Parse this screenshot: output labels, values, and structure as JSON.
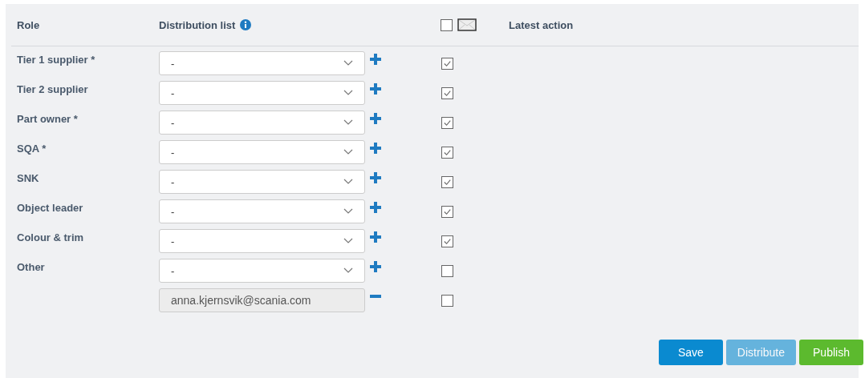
{
  "header": {
    "role": "Role",
    "distribution_list": "Distribution list",
    "select_all_checked": false,
    "latest_action": "Latest action"
  },
  "rows": [
    {
      "kind": "select",
      "role": "Tier 1 supplier *",
      "value": "-",
      "checked": true
    },
    {
      "kind": "select",
      "role": "Tier 2 supplier",
      "value": "-",
      "checked": true
    },
    {
      "kind": "select",
      "role": "Part owner *",
      "value": "-",
      "checked": true
    },
    {
      "kind": "select",
      "role": "SQA *",
      "value": "-",
      "checked": true
    },
    {
      "kind": "select",
      "role": "SNK",
      "value": "-",
      "checked": true
    },
    {
      "kind": "select",
      "role": "Object leader",
      "value": "-",
      "checked": true
    },
    {
      "kind": "select",
      "role": "Colour & trim",
      "value": "-",
      "checked": true
    },
    {
      "kind": "select",
      "role": "Other",
      "value": "-",
      "checked": false
    },
    {
      "kind": "email",
      "value": "anna.kjernsvik@scania.com",
      "checked": false
    }
  ],
  "buttons": [
    {
      "label": "Save",
      "kind": "save",
      "disabled": false
    },
    {
      "label": "Distribute",
      "kind": "distribute",
      "disabled": true
    },
    {
      "label": "Publish",
      "kind": "publish",
      "disabled": false
    }
  ]
}
